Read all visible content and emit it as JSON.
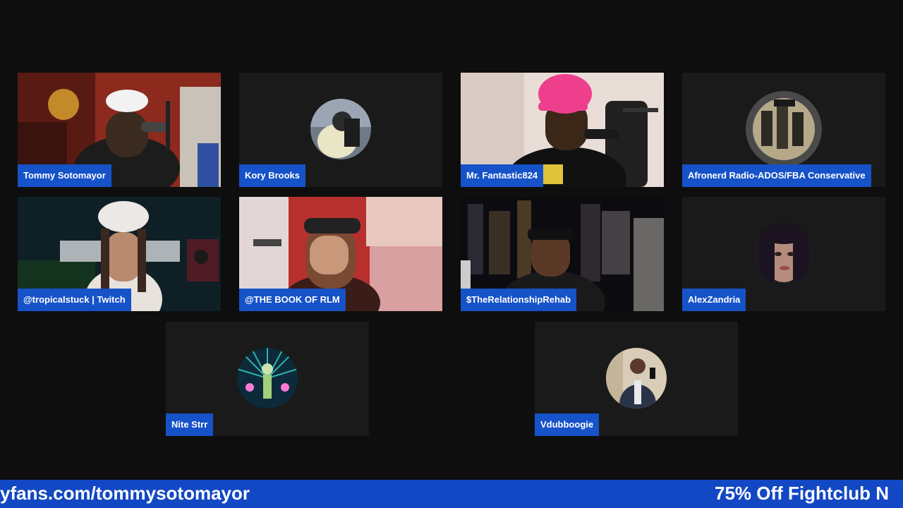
{
  "participants": [
    {
      "name": "Tommy Sotomayor",
      "media": "video"
    },
    {
      "name": "Kory Brooks",
      "media": "avatar"
    },
    {
      "name": "Mr. Fantastic824",
      "media": "video"
    },
    {
      "name": "Afronerd Radio-ADOS/FBA Conservative",
      "media": "avatar"
    },
    {
      "name": "@tropicalstuck | Twitch",
      "media": "video"
    },
    {
      "name": "@THE BOOK OF RLM",
      "media": "video"
    },
    {
      "name": "$TheRelationshipRehab",
      "media": "video"
    },
    {
      "name": "AlexZandria",
      "media": "avatar"
    },
    {
      "name": "Nite Strr",
      "media": "avatar"
    },
    {
      "name": "Vdubboogie",
      "media": "avatar"
    }
  ],
  "ticker": {
    "left_text": "yfans.com/tommysotomayor",
    "right_text": "75% Off Fightclub N"
  },
  "colors": {
    "background": "#0e0e0e",
    "tile": "#1a1a1a",
    "name_tag": "#1652c8",
    "ticker": "#1348c4"
  }
}
